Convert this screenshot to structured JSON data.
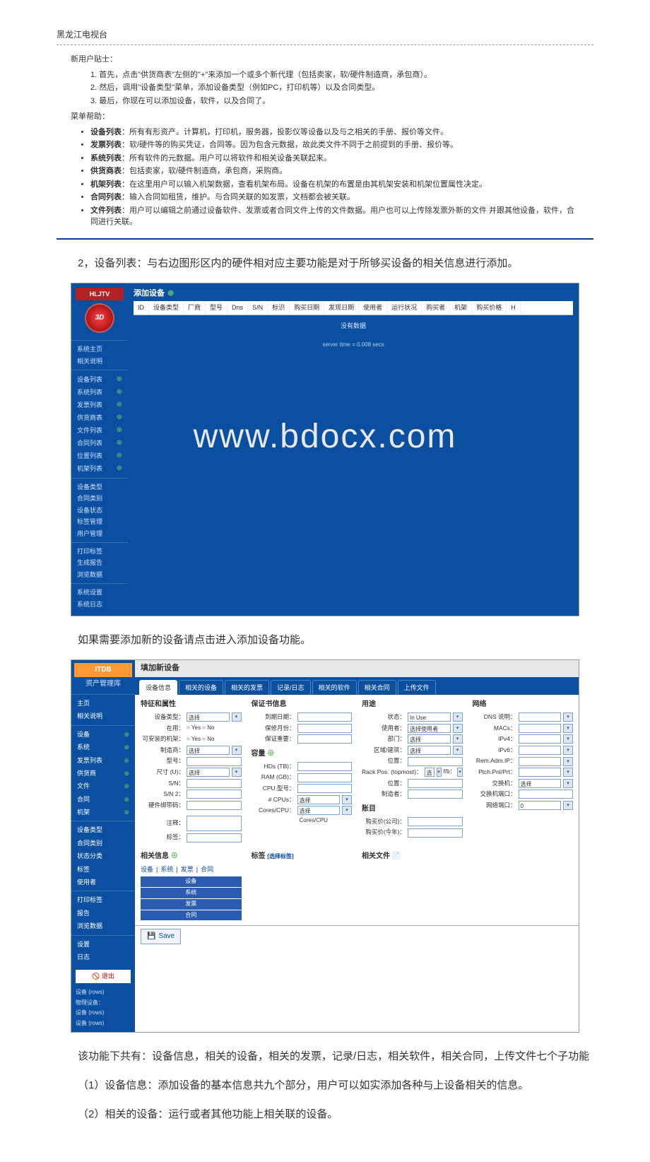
{
  "header_title": "黑龙江电视台",
  "intro": {
    "new_user_tips_title": "新用户贴士：",
    "tips": [
      "1. 首先，点击\"供货商表\"左侧的\"+\"来添加一个或多个新代理（包括卖家，软/硬件制造商，承包商）。",
      "2. 然后，调用\"设备类型\"菜单，添加设备类型（例如PC，打印机等）以及合同类型。",
      "3. 最后，你现在可以添加设备，软件，以及合同了。"
    ],
    "menu_help_title": "菜单帮助：",
    "menu_items": [
      {
        "b": "设备列表",
        "t": "：所有有形资产。计算机，打印机，服务器，投影仪等设备以及与之相关的手册、报价等文件。"
      },
      {
        "b": "发票列表",
        "t": "：软/硬件等的购买凭证，合同等。因为包含元数据，故此类文件不同于之前提到的手册、报价等。"
      },
      {
        "b": "系统列表",
        "t": "：所有软件的元数据。用户可以将软件和相关设备关联起来。"
      },
      {
        "b": "供货商表",
        "t": "：包括卖家，软/硬件制造商，承包商，采购商。"
      },
      {
        "b": "机架列表",
        "t": "：在这里用户可以输入机架数据，查看机架布局。设备在机架的布置是由其机架安装和机架位置属性决定。"
      },
      {
        "b": "合同列表",
        "t": "：输入合同如租赁，维护。与合同关联的如发票，文档都会被关联。"
      },
      {
        "b": "文件列表",
        "t": "：用户可以编辑之前通过设备软件、发票或者合同文件上传的文件数据。用户也可以上传除发票外新的文件 并跟其他设备，软件，合同进行关联。"
      }
    ]
  },
  "para_1": "2，设备列表：与右边图形区内的硬件相对应主要功能是对于所够买设备的相关信息进行添加。",
  "watermark": "www.bdocx.com",
  "shot1": {
    "logo": "HLJTV",
    "badge": "3D",
    "title": "添加设备",
    "table_headers": [
      "ID",
      "设备类型",
      "厂商",
      "型号",
      "Dns",
      "S/N",
      "标识",
      "购买日期",
      "发现日期",
      "使用者",
      "运行状况",
      "购买者",
      "机架",
      "购买价格",
      "H"
    ],
    "no_data": "没有数据",
    "server_time": "server time = 0.008 secs",
    "nav_group1": [
      "系统主页",
      "相关说明"
    ],
    "nav_group2": [
      "设备列表",
      "系统列表",
      "发票列表",
      "供货商表",
      "文件列表",
      "合同列表",
      "位置列表",
      "机架列表"
    ],
    "nav_group3": [
      "设备类型",
      "合同类别",
      "设备状态",
      "标签管理",
      "用户管理"
    ],
    "nav_group4": [
      "打印标签",
      "生成报告",
      "浏览数据"
    ],
    "nav_group5": [
      "系统设置",
      "系统日志"
    ]
  },
  "para_2": "如果需要添加新的设备请点击进入添加设备功能。",
  "shot2": {
    "brand": "ITDB",
    "subbrand": "资产管理库",
    "nav_group1": [
      "主页",
      "相关说明"
    ],
    "nav_group2": [
      "设备",
      "系统",
      "发票列表",
      "供货商",
      "文件",
      "合同",
      "机架"
    ],
    "nav_group3": [
      "设备类型",
      "合同类别",
      "状态分类",
      "标签",
      "使用者"
    ],
    "nav_group4": [
      "打印标签",
      "报告",
      "浏览数据"
    ],
    "nav_group5": [
      "设置",
      "日志"
    ],
    "logout": "退出",
    "footer_mini": [
      "设备 (rows)",
      "物理设备：",
      "设备 (rows)",
      "设备 (rows)"
    ],
    "title": "填加新设备",
    "tabs": [
      "设备信息",
      "相关的设备",
      "相关的发票",
      "记录/日志",
      "相关的软件",
      "相关合同",
      "上传文件"
    ],
    "sections": {
      "attributes": {
        "title": "特征和属性",
        "fields": [
          "设备类型：",
          "在用：",
          "可安装的机架：",
          "制造商：",
          "型号：",
          "尺寸 (U)：",
          "S/N：",
          "S/N 2：",
          "硬件绑带码："
        ],
        "yesno": "Yes    No",
        "select_val": "选择",
        "extra": [
          "注释：",
          "标签："
        ]
      },
      "warranty": {
        "title": "保证书信息",
        "fields": [
          "到期日期：",
          "保修月份：",
          "保证重要："
        ],
        "subtitle": "容量",
        "fields2": [
          "HDs (TB)：",
          "RAM (GB)：",
          "CPU 型号：",
          "# CPUs：",
          "Cores/CPU："
        ],
        "sel2": [
          "选择",
          "选择 Cores/CPU"
        ]
      },
      "usage": {
        "title": "用途",
        "fields": [
          "状态：",
          "使用者：",
          "部门：",
          "区域/建筑：",
          "位置：",
          "Rack Pos. (topmost)：",
          "位置：",
          "制造者："
        ],
        "status_val": "In Use",
        "user_val": "选择使用者",
        "dept_val": "选择",
        "area_val": "选择",
        "rack_sel": "选择",
        "rack_extra": "f/b：",
        "subtitle": "账目",
        "fields2": [
          "购买价(公司)：",
          "购买价(今年)："
        ]
      },
      "network": {
        "title": "网络",
        "fields": [
          "DNS 说明：",
          "MACs：",
          "IPv4：",
          "IPv6：",
          "Rem.Adm.IP：",
          "Ptch.Pnl/Prt：",
          "交换机：",
          "交换机端口：",
          "网络端口："
        ],
        "switch_val": "选择",
        "port_val": "0"
      },
      "related": {
        "title": "相关信息",
        "links": [
          "设备",
          "系统",
          "发票",
          "合同"
        ],
        "rows": [
          "设备",
          "系统",
          "发票",
          "合同"
        ]
      },
      "tags": {
        "title": "标签",
        "link": "[选择标签]"
      },
      "files": {
        "title": "相关文件"
      }
    },
    "save": "Save"
  },
  "para_3": "该功能下共有：设备信息，相关的设备，相关的发票，记录/日志，相关软件，相关合同，上传文件七个子功能",
  "para_4": "（1）设备信息：添加设备的基本信息共九个部分，用户可以如实添加各种与上设备相关的信息。",
  "para_5": "（2）相关的设备：运行或者其他功能上相关联的设备。"
}
